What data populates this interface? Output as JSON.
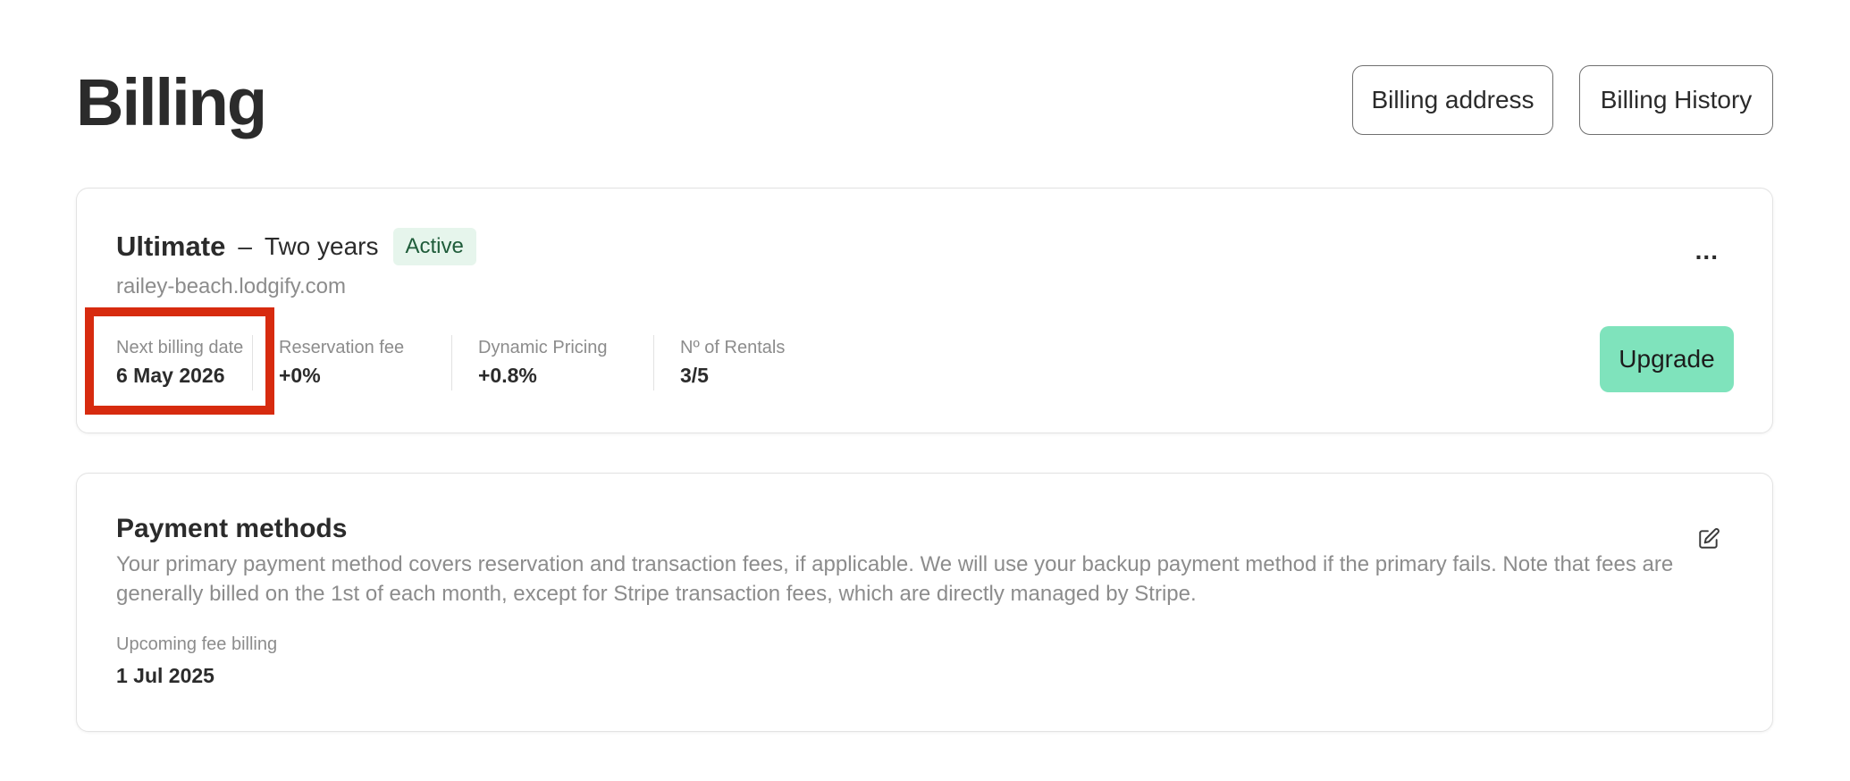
{
  "page": {
    "title": "Billing"
  },
  "header_buttons": {
    "billing_address": "Billing address",
    "billing_history": "Billing History"
  },
  "plan": {
    "name": "Ultimate",
    "separator": "–",
    "term": "Two years",
    "status": "Active",
    "domain": "railey-beach.lodgify.com",
    "more_label": "...",
    "upgrade_label": "Upgrade",
    "stats": [
      {
        "label": "Next billing date",
        "value": "6 May 2026"
      },
      {
        "label": "Reservation fee",
        "value": "+0%"
      },
      {
        "label": "Dynamic Pricing",
        "value": "+0.8%"
      },
      {
        "label": "Nº of Rentals",
        "value": "3/5"
      }
    ]
  },
  "payment_methods": {
    "title": "Payment methods",
    "description": "Your primary payment method covers reservation and transaction fees, if applicable. We will use your backup payment method if the primary fails. Note that fees are generally billed on the 1st of each month, except for Stripe transaction fees, which are directly managed by Stripe.",
    "upcoming_label": "Upcoming fee billing",
    "upcoming_value": "1 Jul 2025"
  },
  "colors": {
    "upgrade_button": "#7fe3bc",
    "status_badge_bg": "#e6f5ec",
    "highlight": "#d72b0f"
  },
  "icons": {
    "more": "more-horizontal-icon",
    "edit": "edit-pencil-icon"
  }
}
